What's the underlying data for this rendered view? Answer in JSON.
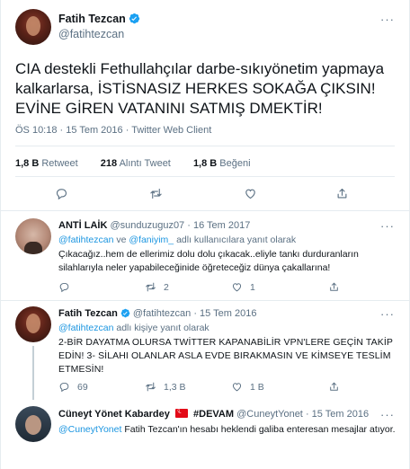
{
  "main": {
    "name": "Fatih Tezcan",
    "handle": "@fatihtezcan",
    "text": "CIA destekli Fethullahçılar darbe-sıkıyönetim yapmaya kalkarlarsa, İSTİSNASIZ HERKES SOKAĞA ÇIKSIN! EVİNE GİREN VATANINI SATMIŞ DMEKTİR!",
    "meta": "ÖS 10:18 · 15 Tem 2016 · Twitter Web Client",
    "stats": {
      "retweets_count": "1,8 B",
      "retweets_label": "Retweet",
      "quotes_count": "218",
      "quotes_label": "Alıntı Tweet",
      "likes_count": "1,8 B",
      "likes_label": "Beğeni"
    },
    "more_label": "···"
  },
  "replies": [
    {
      "name": "ANTİ LAİK",
      "handle": "@sunduzuguz07",
      "date": "· 16 Tem 2017",
      "reply_to_user1": "@fatihtezcan",
      "reply_to_and": "ve",
      "reply_to_user2": "@faniyim_",
      "reply_to_suffix": "adlı kullanıcılara yanıt olarak",
      "text": "Çıkacağız..hem de ellerimiz dolu dolu çıkacak..eliyle tankı durduranların silahlarıyla neler yapabileceğinide öğreteceğiz dünya çakallarına!",
      "retweets": "2",
      "likes": "1"
    },
    {
      "name": "Fatih Tezcan",
      "handle": "@fatihtezcan",
      "date": "· 15 Tem 2016",
      "reply_to_user1": "@fatihtezcan",
      "reply_to_suffix": "adlı kişiye yanıt olarak",
      "text": "2-BİR DAYATMA OLURSA TWİTTER KAPANABİLİR VPN'LERE GEÇİN TAKİP EDİN! 3- SİLAHI OLANLAR ASLA EVDE BIRAKMASIN VE KİMSEYE TESLİM ETMESİN!",
      "replies": "69",
      "retweets": "1,3 B",
      "likes": "1 B"
    },
    {
      "name": "Cüneyt Yönet Kabardey",
      "hashtag": "#DEVAM",
      "handle": "@CuneytYonet",
      "date": "· 15 Tem 2016",
      "mention": "@CuneytYonet",
      "text": "Fatih Tezcan'ın hesabı heklendi galiba enteresan mesajlar atıyor."
    }
  ],
  "colors": {
    "link": "#1b95e0",
    "muted": "#5b7083",
    "text": "#0f1419",
    "divider": "#e6ecf0"
  }
}
